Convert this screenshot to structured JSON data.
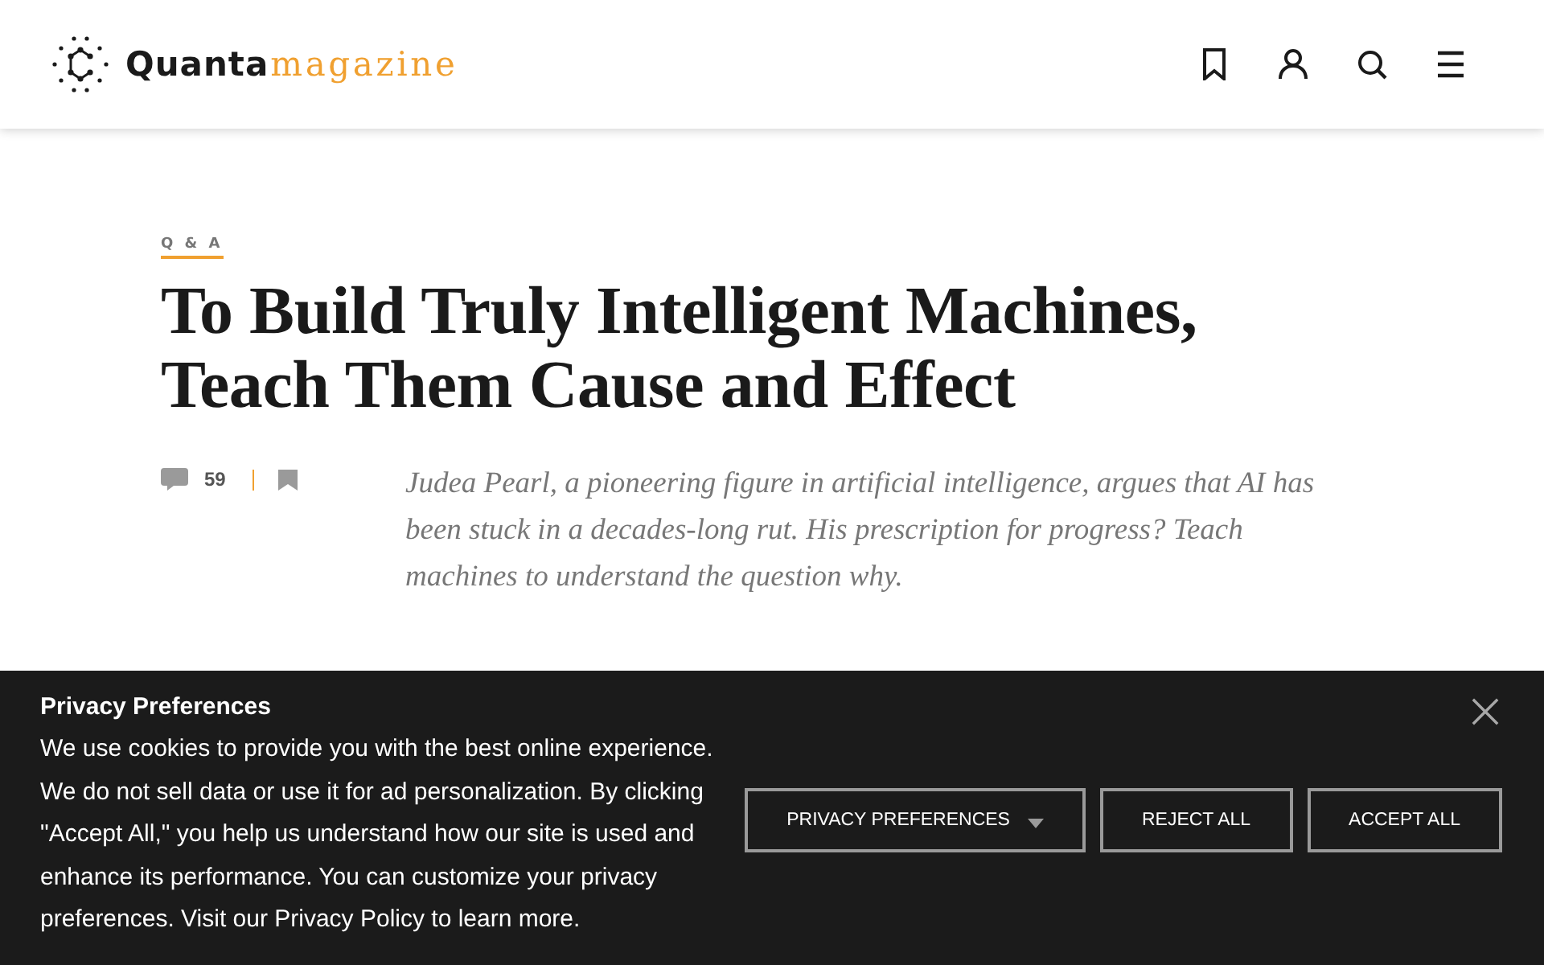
{
  "header": {
    "logo": {
      "wordmark": "Quanta",
      "suffix": "magazine"
    }
  },
  "article": {
    "kicker": "Q & A",
    "title": "To Build Truly Intelligent Machines, Teach Them Cause and Effect",
    "comment_count": "59",
    "deck": "Judea Pearl, a pioneering figure in artificial intelligence, argues that AI has been stuck in a decades-long rut. His prescription for progress? Teach machines to understand the question why."
  },
  "cookie_banner": {
    "title": "Privacy Preferences",
    "text": "We use cookies to provide you with the best online experience. We do not sell data or use it for ad personalization. By clicking \"Accept All,\" you help us understand how our site is used and enhance its performance. You can customize your privacy preferences. Visit our Privacy Policy to learn more.",
    "buttons": [
      {
        "label": "PRIVACY PREFERENCES",
        "kind": "dropdown"
      },
      {
        "label": "REJECT ALL",
        "kind": "plain"
      },
      {
        "label": "ACCEPT ALL",
        "kind": "plain"
      }
    ]
  }
}
